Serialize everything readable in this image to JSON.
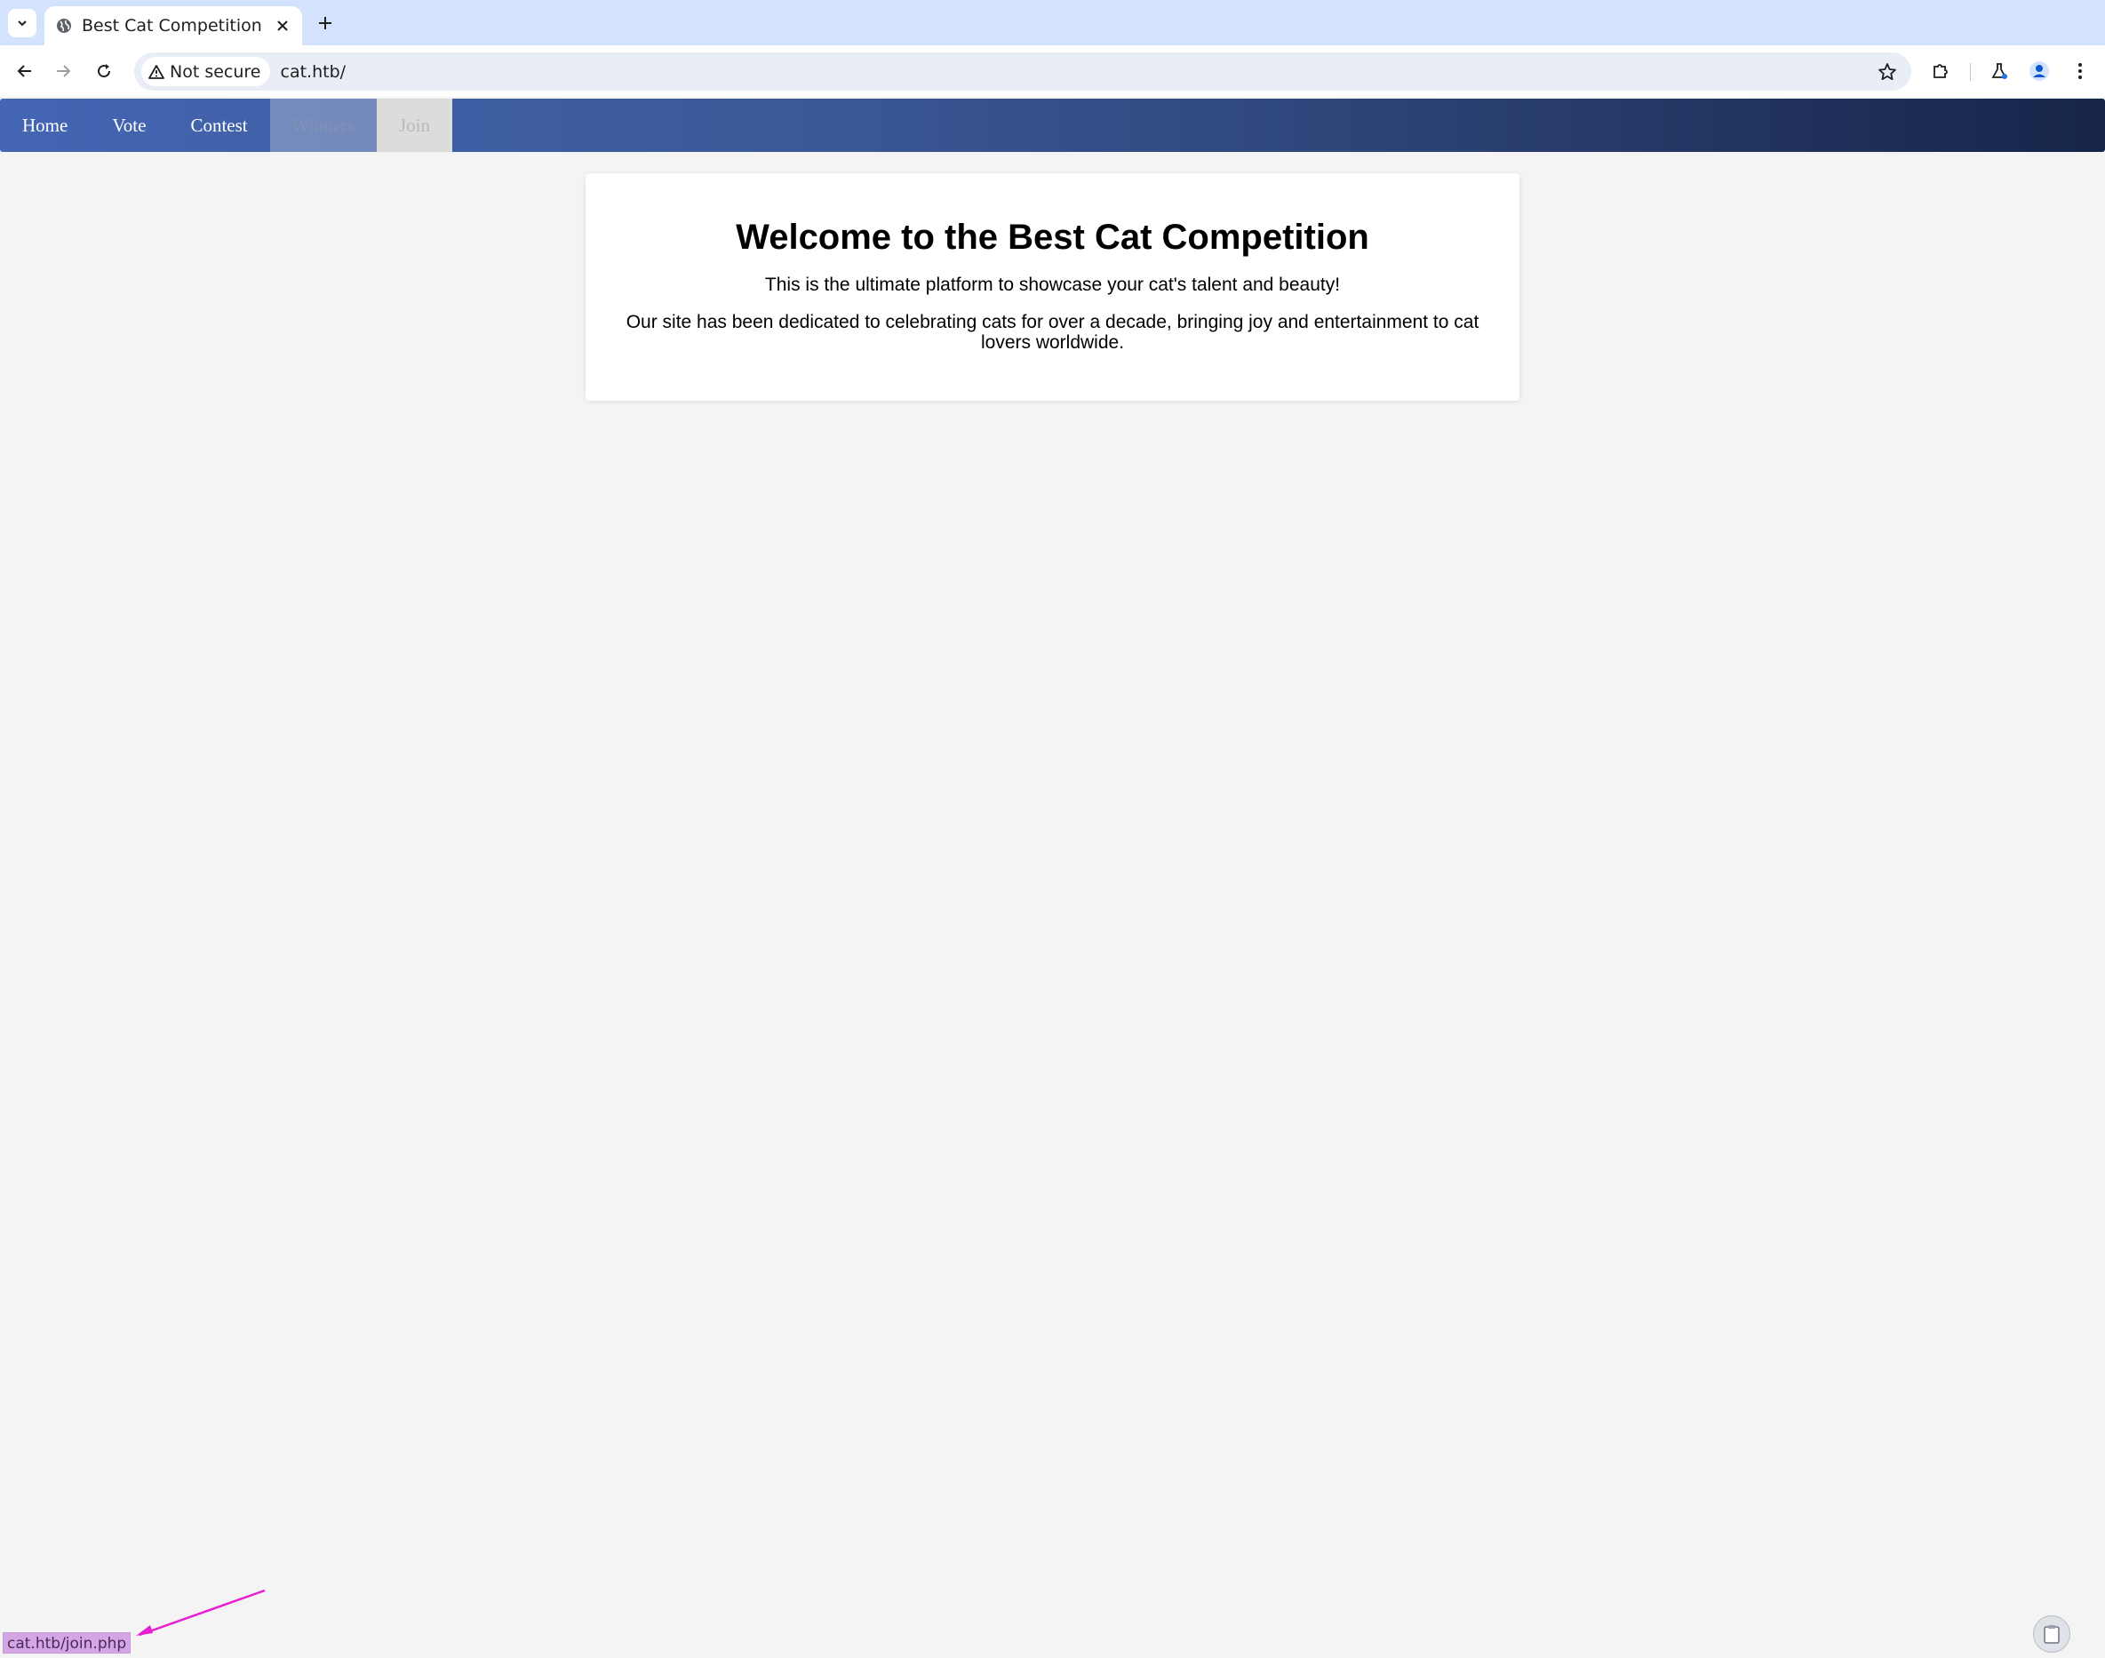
{
  "browser": {
    "tab_title": "Best Cat Competition",
    "security_label": "Not secure",
    "url": "cat.htb/"
  },
  "site_nav": {
    "items": [
      {
        "label": "Home"
      },
      {
        "label": "Vote"
      },
      {
        "label": "Contest"
      },
      {
        "label": "Winners"
      },
      {
        "label": "Join"
      }
    ]
  },
  "main": {
    "heading": "Welcome to the Best Cat Competition",
    "paragraph1": "This is the ultimate platform to showcase your cat's talent and beauty!",
    "paragraph2": "Our site has been dedicated to celebrating cats for over a decade, bringing joy and entertainment to cat lovers worldwide."
  },
  "status_bar": {
    "hover_url": "cat.htb/join.php"
  },
  "colors": {
    "annotation": "#e81fd0"
  }
}
